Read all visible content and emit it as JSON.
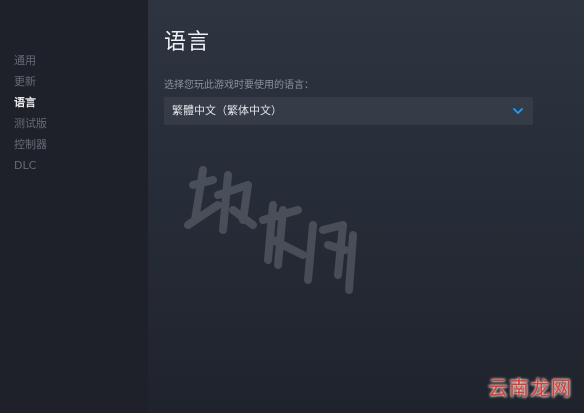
{
  "sidebar": {
    "items": [
      {
        "label": "通用",
        "active": false
      },
      {
        "label": "更新",
        "active": false
      },
      {
        "label": "语言",
        "active": true
      },
      {
        "label": "测试版",
        "active": false
      },
      {
        "label": "控制器",
        "active": false
      },
      {
        "label": "DLC",
        "active": false
      }
    ]
  },
  "main": {
    "title": "语言",
    "language_field": {
      "label": "选择您玩此游戏时要使用的语言：",
      "value": "繁體中文（繁体中文）",
      "icon": "chevron-down-icon"
    }
  },
  "site_mark": "云南龙网",
  "colors": {
    "accent": "#1a9fff",
    "site_mark": "#e23a2d"
  }
}
